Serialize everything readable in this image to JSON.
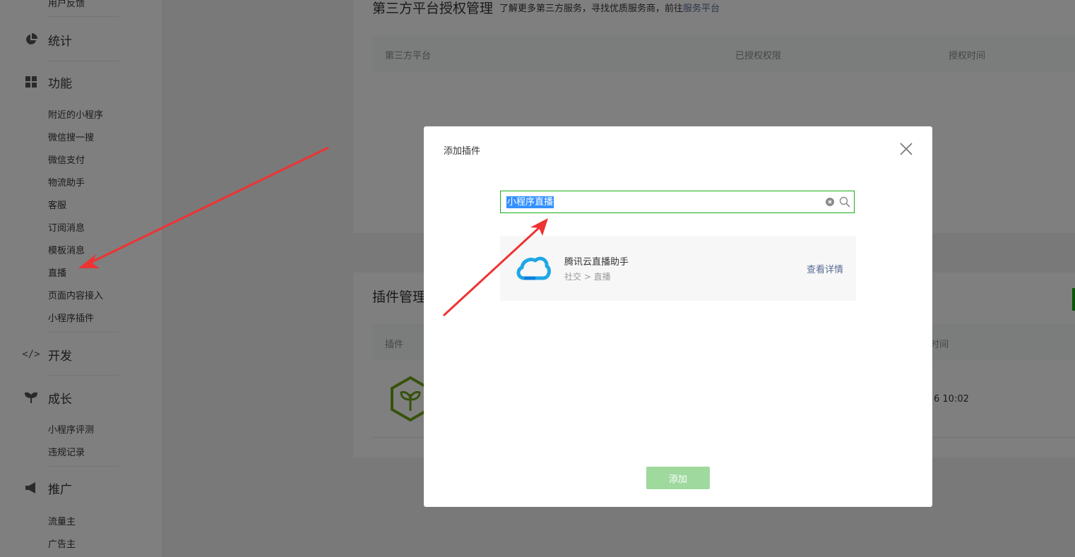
{
  "sidebar": {
    "top_item": "用户反馈",
    "sections": [
      {
        "label": "统计"
      },
      {
        "label": "功能"
      },
      {
        "label": "开发"
      },
      {
        "label": "成长"
      },
      {
        "label": "推广"
      }
    ],
    "function_items": [
      "附近的小程序",
      "微信搜一搜",
      "微信支付",
      "物流助手",
      "客服",
      "订阅消息",
      "模板消息",
      "直播",
      "页面内容接入",
      "小程序插件"
    ],
    "growth_items": [
      "小程序评测",
      "违规记录"
    ],
    "promo_items": [
      "流量主",
      "广告主"
    ]
  },
  "third_party": {
    "title": "第三方平台授权管理",
    "desc": "了解更多第三方服务，寻找优质服务商，前往",
    "desc_link": "服务平台",
    "columns": [
      "第三方平台",
      "已授权权限",
      "授权时间"
    ]
  },
  "plugin_mgmt": {
    "title": "插件管理",
    "columns": [
      "插件",
      "时间"
    ],
    "row_time": "6 10:02"
  },
  "modal": {
    "title": "添加插件",
    "search_value": "小程序直播",
    "result": {
      "name": "腾讯云直播助手",
      "category": "社交 > 直播",
      "link": "查看详情"
    },
    "add_button": "添加"
  },
  "colors": {
    "accent_green": "#1aad19",
    "link_blue": "#576b95",
    "annotation_red": "#ee3333"
  }
}
